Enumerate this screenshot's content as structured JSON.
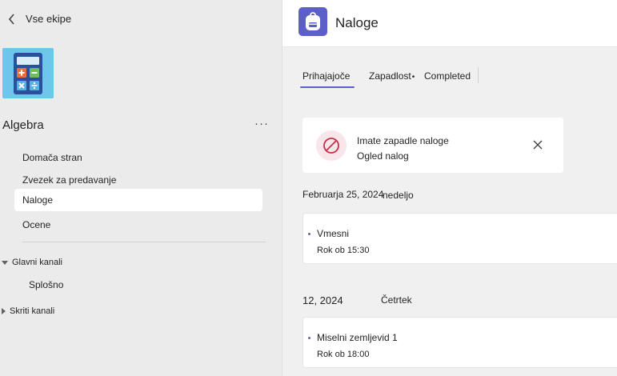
{
  "sidebar": {
    "back_label": "Vse ekipe",
    "team_name": "Algebra",
    "more_label": "···",
    "nav": [
      {
        "label": "Domača stran"
      },
      {
        "label": "Zvezek za predavanje"
      },
      {
        "label": "Naloge"
      },
      {
        "label": "Ocene"
      }
    ],
    "sections": [
      {
        "label": "Glavni kanali",
        "expanded": true,
        "channels": [
          "Splošno"
        ]
      },
      {
        "label": "Skriti kanali",
        "expanded": false
      }
    ]
  },
  "header": {
    "title": "Naloge",
    "icon": "backpack-icon"
  },
  "tabs": [
    {
      "label": "Prihajajoče",
      "active": true
    },
    {
      "label": "Zapadlost",
      "badge": "•"
    },
    {
      "label": "Completed"
    }
  ],
  "banner": {
    "title": "Imate zapadle naloge",
    "link": "Ogled nalog",
    "icon": "blocked-icon"
  },
  "groups": [
    {
      "date": "Februarja 25, 2024",
      "day": "nedeljo",
      "items": [
        {
          "title": "Vmesni",
          "due": "Rok ob 15:30"
        }
      ]
    },
    {
      "date": "12, 2024",
      "day": "Četrtek",
      "items": [
        {
          "title": "Miselni zemljevid 1",
          "due": "Rok ob 18:00"
        }
      ]
    }
  ],
  "colors": {
    "accent": "#5b5fc7",
    "team_tile": "#6fc6ec",
    "sidebar_bg": "#ebebeb",
    "content_bg": "#f0f0f0"
  }
}
